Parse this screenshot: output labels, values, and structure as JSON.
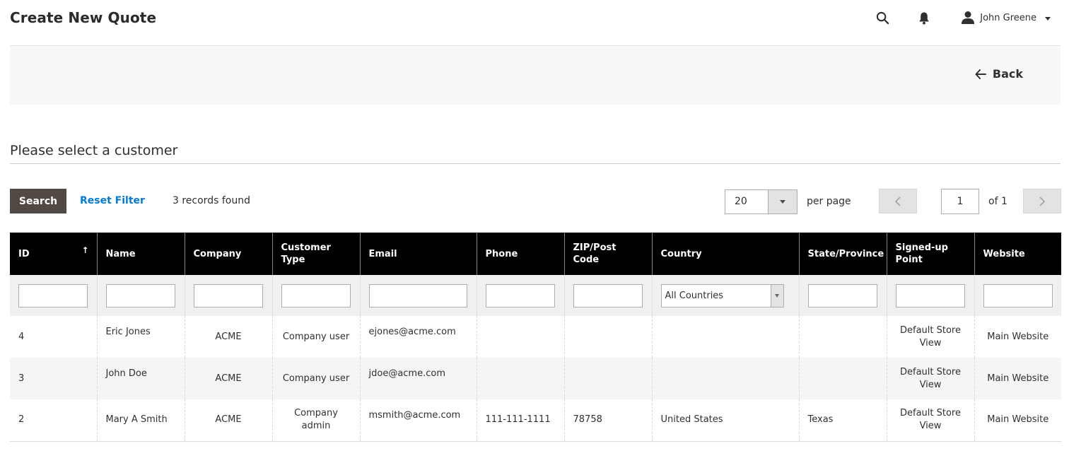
{
  "header": {
    "title": "Create New Quote",
    "user_name": "John Greene"
  },
  "actions": {
    "back_label": "Back"
  },
  "section": {
    "title": "Please select a customer"
  },
  "toolbar": {
    "search_label": "Search",
    "reset_label": "Reset Filter",
    "records_text": "3 records found",
    "per_page_value": "20",
    "per_page_label": "per page",
    "current_page": "1",
    "page_of": "of 1"
  },
  "table": {
    "columns": [
      "ID",
      "Name",
      "Company",
      "Customer Type",
      "Email",
      "Phone",
      "ZIP/Post Code",
      "Country",
      "State/Province",
      "Signed-up Point",
      "Website"
    ],
    "country_filter": "All Countries",
    "rows": [
      {
        "id": "4",
        "name": "Eric Jones",
        "company": "ACME",
        "type": "Company user",
        "email": "ejones@acme.com",
        "phone": "",
        "zip": "",
        "country": "",
        "state": "",
        "signup": "Default Store View",
        "website": "Main Website"
      },
      {
        "id": "3",
        "name": "John Doe",
        "company": "ACME",
        "type": "Company user",
        "email": "jdoe@acme.com",
        "phone": "",
        "zip": "",
        "country": "",
        "state": "",
        "signup": "Default Store View",
        "website": "Main Website"
      },
      {
        "id": "2",
        "name": "Mary A Smith",
        "company": "ACME",
        "type": "Company admin",
        "email": "msmith@acme.com",
        "phone": "111-111-1111",
        "zip": "78758",
        "country": "United States",
        "state": "Texas",
        "signup": "Default Store View",
        "website": "Main Website"
      }
    ]
  },
  "colors": {
    "header_bg": "#000000",
    "primary_button": "#514943",
    "link": "#007bdb"
  }
}
